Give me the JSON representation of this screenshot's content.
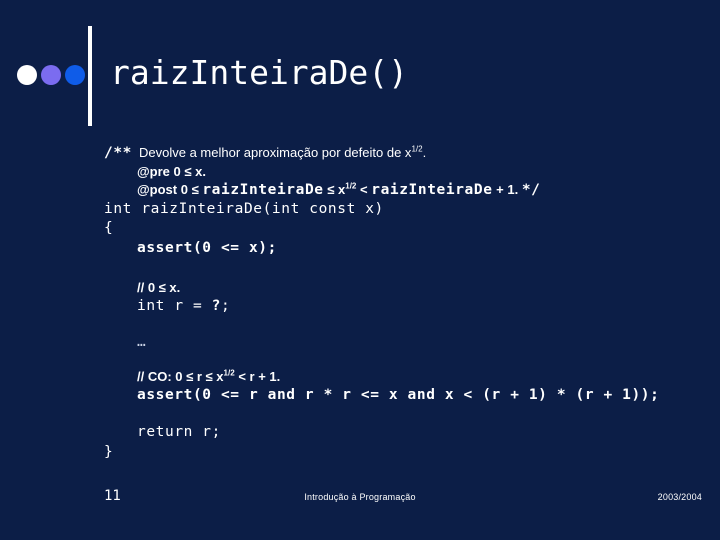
{
  "slide": {
    "background_color": "#0c1e47",
    "text_color": "#ffffff"
  },
  "header": {
    "title": "raizInteiraDe()",
    "bullets": [
      {
        "name": "bullet-white",
        "color": "#ffffff"
      },
      {
        "name": "bullet-purple",
        "color": "#7b6cf0"
      },
      {
        "name": "bullet-blue",
        "color": "#0f5ce8"
      }
    ]
  },
  "code": {
    "doc_open": "/**",
    "doc_line1_a": "Devolve a melhor aproximação por defeito de x",
    "doc_line1_sup": "1/2",
    "doc_line1_b": ".",
    "doc_pre": "@pre 0 ≤ x.",
    "doc_post_a": "@post 0 ≤ ",
    "doc_post_fn1": "raizInteiraDe",
    "doc_post_b": " ≤ x",
    "doc_post_sup": "1/2",
    "doc_post_c": " < ",
    "doc_post_fn2": "raizInteiraDe",
    "doc_post_d": " + 1. ",
    "doc_close": "*/",
    "signature": "int raizInteiraDe(int const x)",
    "brace_open": "{",
    "assert_pre": "assert(0 <= x);",
    "comment_pre_a": "// 0 ≤ x.",
    "decl_a": "int r = ",
    "decl_q": "?",
    "decl_b": ";",
    "ellipsis": "…",
    "comment_co_a": "// CO: 0 ≤ r ≤ x",
    "comment_co_sup": "1/2",
    "comment_co_b": " < r + 1.",
    "assert_post": "assert(0 <= r and r * r <= x and x < (r + 1) * (r + 1));",
    "return_stmt": "return r;",
    "brace_close": "}"
  },
  "footer": {
    "page_number": "11",
    "course": "Introdução à Programação",
    "year": "2003/2004"
  }
}
